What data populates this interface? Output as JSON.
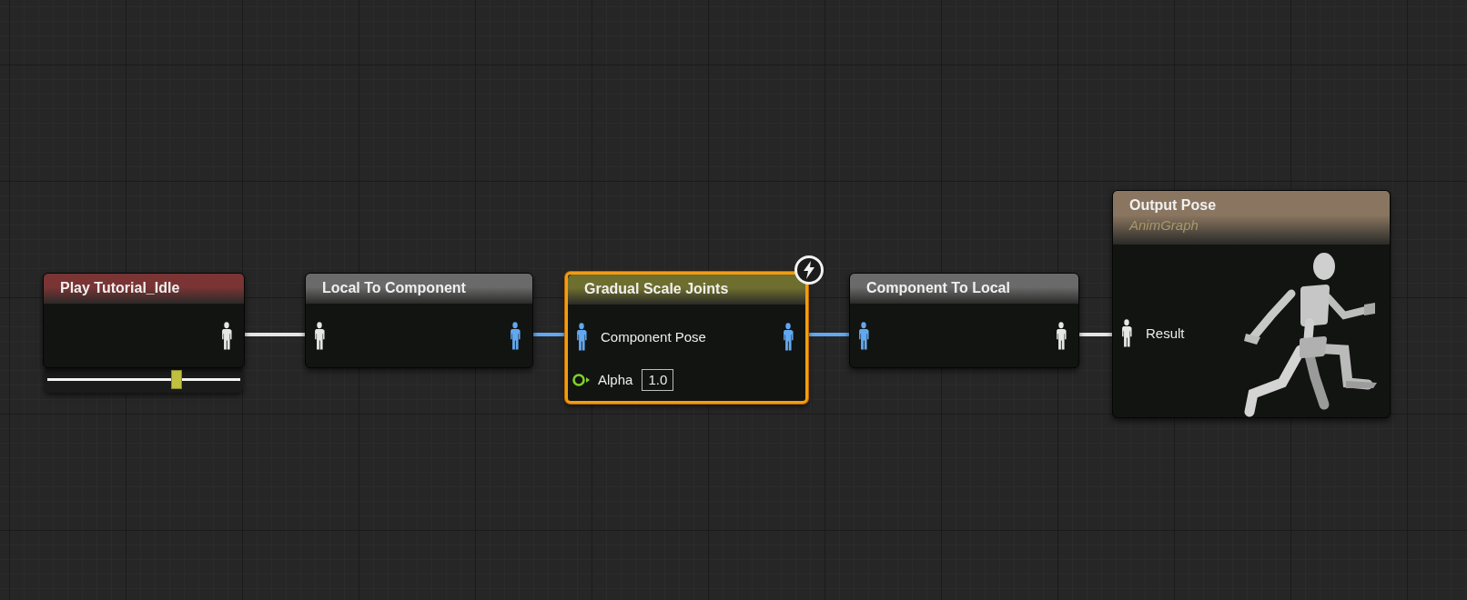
{
  "nodes": [
    {
      "title": "Play Tutorial_Idle",
      "color": "#7a3434",
      "selected": false,
      "outputs": [
        {
          "component_space": false
        }
      ],
      "slider": {
        "level": 0.67
      }
    },
    {
      "title": "Local To Component",
      "color": "#6a6a6a",
      "selected": false,
      "inputs": [
        {
          "kind": "pose",
          "component_space": false
        }
      ],
      "outputs": [
        {
          "component_space": true
        }
      ]
    },
    {
      "title": "Gradual Scale Joints",
      "color": "#6e6e2e",
      "selected": true,
      "fast_path": true,
      "inputs": [
        {
          "kind": "pose",
          "component_space": true,
          "label": "Component Pose"
        },
        {
          "kind": "float",
          "label": "Alpha",
          "value": "1.0"
        }
      ],
      "outputs": [
        {
          "component_space": true
        }
      ]
    },
    {
      "title": "Component To Local",
      "color": "#6a6a6a",
      "selected": false,
      "inputs": [
        {
          "kind": "pose",
          "component_space": true
        }
      ],
      "outputs": [
        {
          "component_space": false
        }
      ]
    },
    {
      "title": "Output Pose",
      "subtitle": "AnimGraph",
      "color": "#8a7660",
      "selected": false,
      "preview": true,
      "inputs": [
        {
          "kind": "pose",
          "component_space": false,
          "label": "Result"
        }
      ]
    }
  ]
}
